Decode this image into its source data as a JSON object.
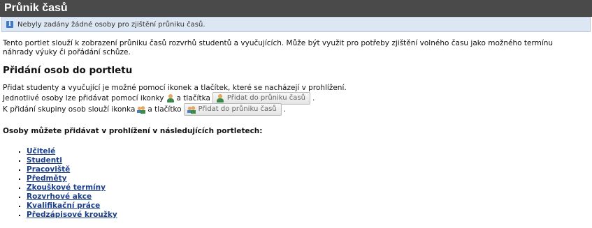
{
  "header": {
    "title": "Průnik časů"
  },
  "info": {
    "icon": "info-icon",
    "message": "Nebyly zadány žádné osoby pro zjištění průniku časů."
  },
  "intro": "Tento portlet slouží k zobrazení průniku časů rozvrhů studentů a vyučujících. Může být využit pro potřeby zjištění volného času jako možného termínu náhrady výuky či pořádání schůze.",
  "add_section": {
    "heading": "Přidání osob do portletu",
    "line1": "Přidat studenty a vyučující je možné pomocí ikonek a tlačítek, které se nacházejí v prohlížení.",
    "line2_before": "Jednotlivé osoby lze přidávat pomocí ikonky",
    "line2_middle": "a tlačítka",
    "line3_before": "K přidání skupiny osob slouží ikonka",
    "line3_middle": "a tlačítko",
    "period": ".",
    "button_label": "Přidat do průniku časů"
  },
  "persons_heading": "Osoby můžete přidávat v prohlížení v následujících portletech:",
  "links": [
    "Učitelé",
    "Studenti",
    "Pracoviště",
    "Předměty",
    "Zkouškové termíny",
    "Rozvrhové akce",
    "Kvalifikační práce",
    "Předzápisové kroužky"
  ]
}
